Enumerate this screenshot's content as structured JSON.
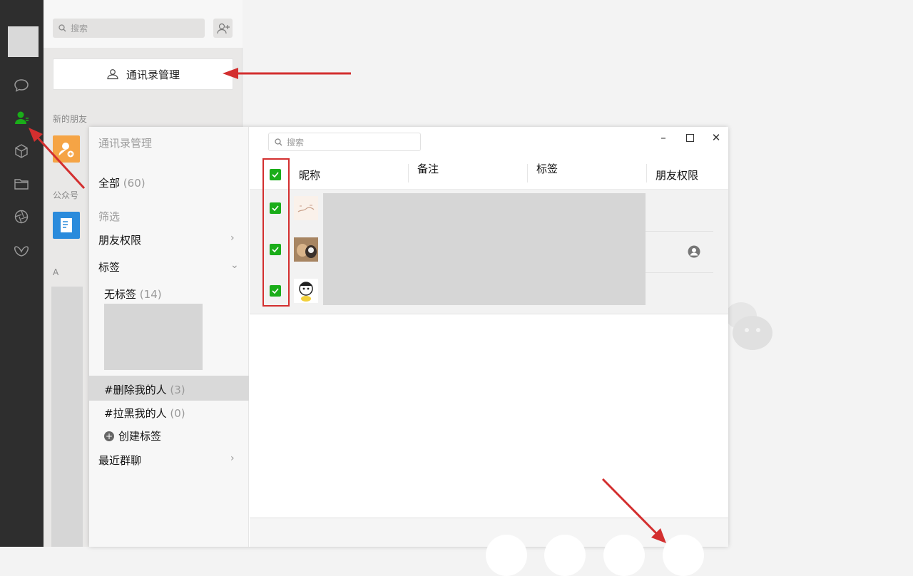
{
  "sidebar": {
    "icons": [
      "chat-icon",
      "contacts-icon",
      "cube-icon",
      "folder-icon",
      "aperture-icon",
      "butterfly-icon"
    ]
  },
  "contacts": {
    "search_placeholder": "搜索",
    "manage_button": "通讯录管理",
    "section_new_friends": "新的朋友",
    "section_official": "公众号",
    "section_a": "A"
  },
  "dialog": {
    "title": "通讯录管理",
    "search_placeholder": "搜索",
    "all_label": "全部",
    "all_count": "(60)",
    "filter_label": "筛选",
    "friend_perm_label": "朋友权限",
    "tags_label": "标签",
    "no_tag_label": "无标签",
    "no_tag_count": "(14)",
    "deleted_me_label": "#删除我的人",
    "deleted_me_count": "(3)",
    "blocked_me_label": "#拉黑我的人",
    "blocked_me_count": "(0)",
    "create_tag_label": "创建标签",
    "recent_groups_label": "最近群聊",
    "columns": [
      "昵称",
      "备注",
      "标签",
      "朋友权限"
    ]
  },
  "colors": {
    "accent_green": "#1aad19",
    "annotation_red": "#d32f2f",
    "rail_bg": "#2e2e2e"
  }
}
